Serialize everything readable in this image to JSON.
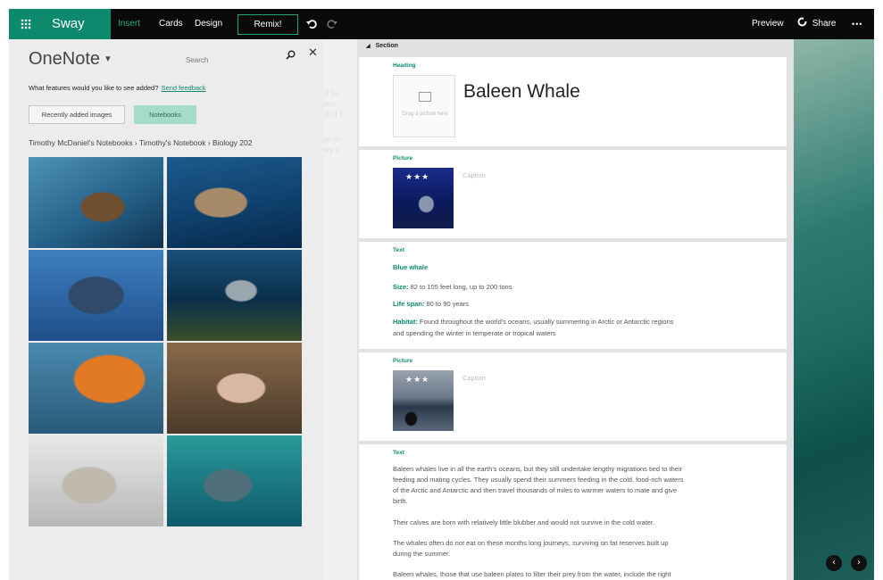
{
  "app": {
    "name": "Sway"
  },
  "nav": {
    "tabs": [
      "Insert",
      "Cards",
      "Design"
    ],
    "remix": "Remix!"
  },
  "toolbar_right": {
    "preview": "Preview",
    "share": "Share",
    "more": "•••"
  },
  "panel": {
    "title": "OneNote",
    "search_placeholder": "Search",
    "feedback_question": "What features would you like to see added?",
    "feedback_link": "Send feedback",
    "buttons": {
      "recent": "Recently added images",
      "notebooks": "Notebooks"
    },
    "breadcrumb": "Timothy McDaniel's Notebooks › Timothy's Notebook › Biology 202"
  },
  "editor": {
    "section_label": "Section",
    "heading_card": {
      "label": "Heading",
      "placeholder": "Drag a picture here",
      "text": "Baleen Whale"
    },
    "picture_card_1": {
      "label": "Picture",
      "caption": "Caption"
    },
    "text_card_1": {
      "label": "Text",
      "subheading": "Blue whale",
      "size_label": "Size:",
      "size_value": " 82 to 105 feet long, up to 200 tons",
      "lifespan_label": "Life span:",
      "lifespan_value": " 80 to 90 years",
      "habitat_label": "Habitat:",
      "habitat_value": " Found throughout the world's oceans, usually summering in Arctic or Antarctic regions",
      "habitat_line2": "and spending the winter in temperate or tropical waters"
    },
    "picture_card_2": {
      "label": "Picture",
      "caption": "Caption"
    },
    "text_card_2": {
      "label": "Text",
      "p1_l1": "Baleen whales live in all the earth's oceans, but they still undertake lengthy migrations tied to their",
      "p1_l2": "feeding and mating cycles. They usually spend their summers feeding in the cold, food-rich waters",
      "p1_l3": "of the Arctic and Antarctic and then travel thousands of miles to warmer waters to mate and give",
      "p1_l4": "birth.",
      "p2": "Their calves are born with relatively little blubber and would not survive in the cold water.",
      "p3_l1": "The whales often do not eat on these months long journeys, surviving on fat reserves built up",
      "p3_l2": "during the summer.",
      "p4": "Baleen whales, those that use baleen plates to filter their prey from the water, include the right"
    }
  },
  "icons": {
    "waffle": "app-launcher-icon",
    "undo": "undo-icon",
    "redo": "redo-icon",
    "share": "share-icon",
    "search": "search-icon",
    "close": "close-icon",
    "prev": "chevron-left-icon",
    "next": "chevron-right-icon"
  },
  "colors": {
    "brand": "#0d8a6d",
    "topbar": "#0a0a0a",
    "panel_bg": "#ececec",
    "active_button": "#a5dbcb"
  }
}
